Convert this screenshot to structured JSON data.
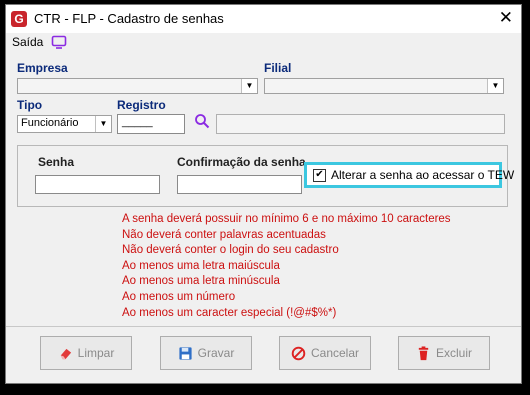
{
  "window": {
    "title": "CTR - FLP - Cadastro de senhas",
    "app_icon_letter": "G",
    "close_glyph": "✕"
  },
  "menu": {
    "saida_label": "Saída",
    "saida_icon": "tv-icon"
  },
  "form": {
    "empresa_label": "Empresa",
    "empresa_value": "",
    "filial_label": "Filial",
    "filial_value": "",
    "tipo_label": "Tipo",
    "tipo_value": "Funcionário",
    "registro_label": "Registro",
    "registro_value": "_____",
    "registro_name_value": ""
  },
  "password": {
    "senha_label": "Senha",
    "senha_value": "",
    "confirmacao_label": "Confirmação da senha",
    "confirmacao_value": "",
    "checkbox_label": "Alterar a senha ao acessar o TEW",
    "checkbox_checked": true,
    "check_glyph": "✔"
  },
  "rules": [
    "A senha deverá possuir no mínimo 6 e no máximo 10 caracteres",
    "Não deverá conter palavras acentuadas",
    "Não deverá conter o login do seu cadastro",
    "Ao menos uma letra maiúscula",
    "Ao menos uma letra minúscula",
    "Ao menos um número",
    "Ao menos um caracter especial (!@#$%*)"
  ],
  "buttons": {
    "limpar": "Limpar",
    "gravar": "Gravar",
    "cancelar": "Cancelar",
    "excluir": "Excluir"
  },
  "colors": {
    "rules_text": "#cc1010",
    "highlight": "#3cc7e0",
    "label_blue": "#0b2a7a",
    "accent_purple": "#8b2be2"
  }
}
